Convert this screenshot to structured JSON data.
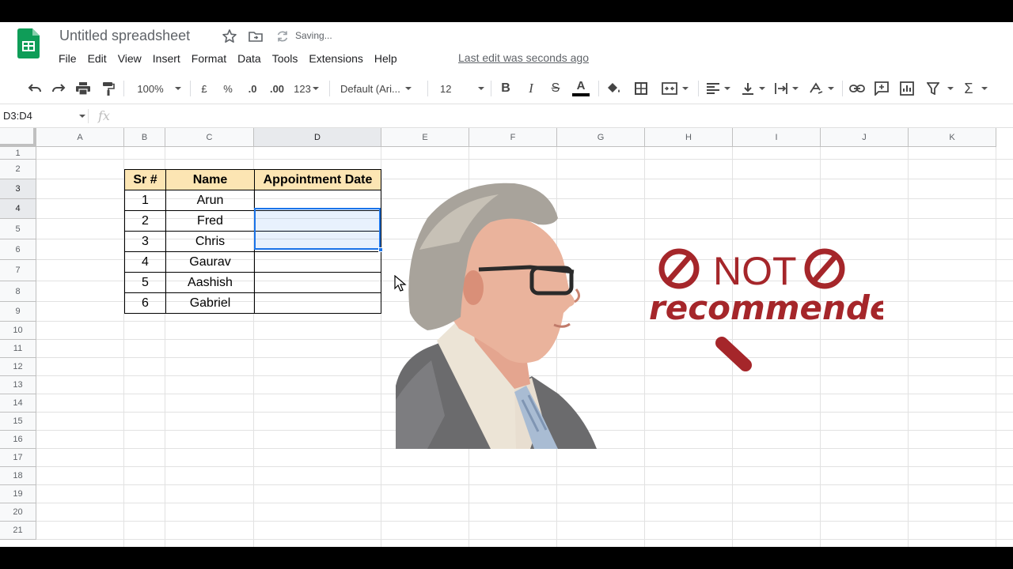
{
  "app": {
    "title": "Untitled spreadsheet",
    "saving_status": "Saving...",
    "last_edit": "Last edit was seconds ago"
  },
  "menu": [
    "File",
    "Edit",
    "View",
    "Insert",
    "Format",
    "Data",
    "Tools",
    "Extensions",
    "Help"
  ],
  "toolbar": {
    "zoom": "100%",
    "currency": "£",
    "percent": "%",
    "decrease_decimal": ".0",
    "increase_decimal": ".00",
    "more_formats": "123",
    "font": "Default (Ari...",
    "font_size": "12",
    "bold": "B",
    "italic": "I",
    "strikethrough": "S",
    "text_color": "A",
    "sum": "Σ"
  },
  "formula_bar": {
    "name_box": "D3:D4",
    "fx": "fx"
  },
  "columns": [
    "A",
    "B",
    "C",
    "D",
    "E",
    "F",
    "G",
    "H",
    "I",
    "J",
    "K"
  ],
  "selected_columns": [
    "D"
  ],
  "rows": [
    "1",
    "2",
    "3",
    "4",
    "5",
    "6",
    "7",
    "8",
    "9",
    "10",
    "11",
    "12",
    "13",
    "14",
    "15",
    "16",
    "17",
    "18",
    "19",
    "20",
    "21"
  ],
  "selected_rows": [
    "3",
    "4"
  ],
  "table": {
    "headers": [
      "Sr #",
      "Name",
      "Appointment Date"
    ],
    "rows": [
      [
        "1",
        "Arun",
        ""
      ],
      [
        "2",
        "Fred",
        ""
      ],
      [
        "3",
        "Chris",
        ""
      ],
      [
        "4",
        "Gaurav",
        ""
      ],
      [
        "5",
        "Aashish",
        ""
      ],
      [
        "6",
        "Gabriel",
        ""
      ]
    ]
  },
  "overlay": {
    "text_line1": "NOT",
    "text_line2": "recommended",
    "color": "#a5262a"
  },
  "colors": {
    "header_fill": "#fce5b3",
    "selection": "#1a73e8",
    "sheets_green": "#0f9d58"
  }
}
